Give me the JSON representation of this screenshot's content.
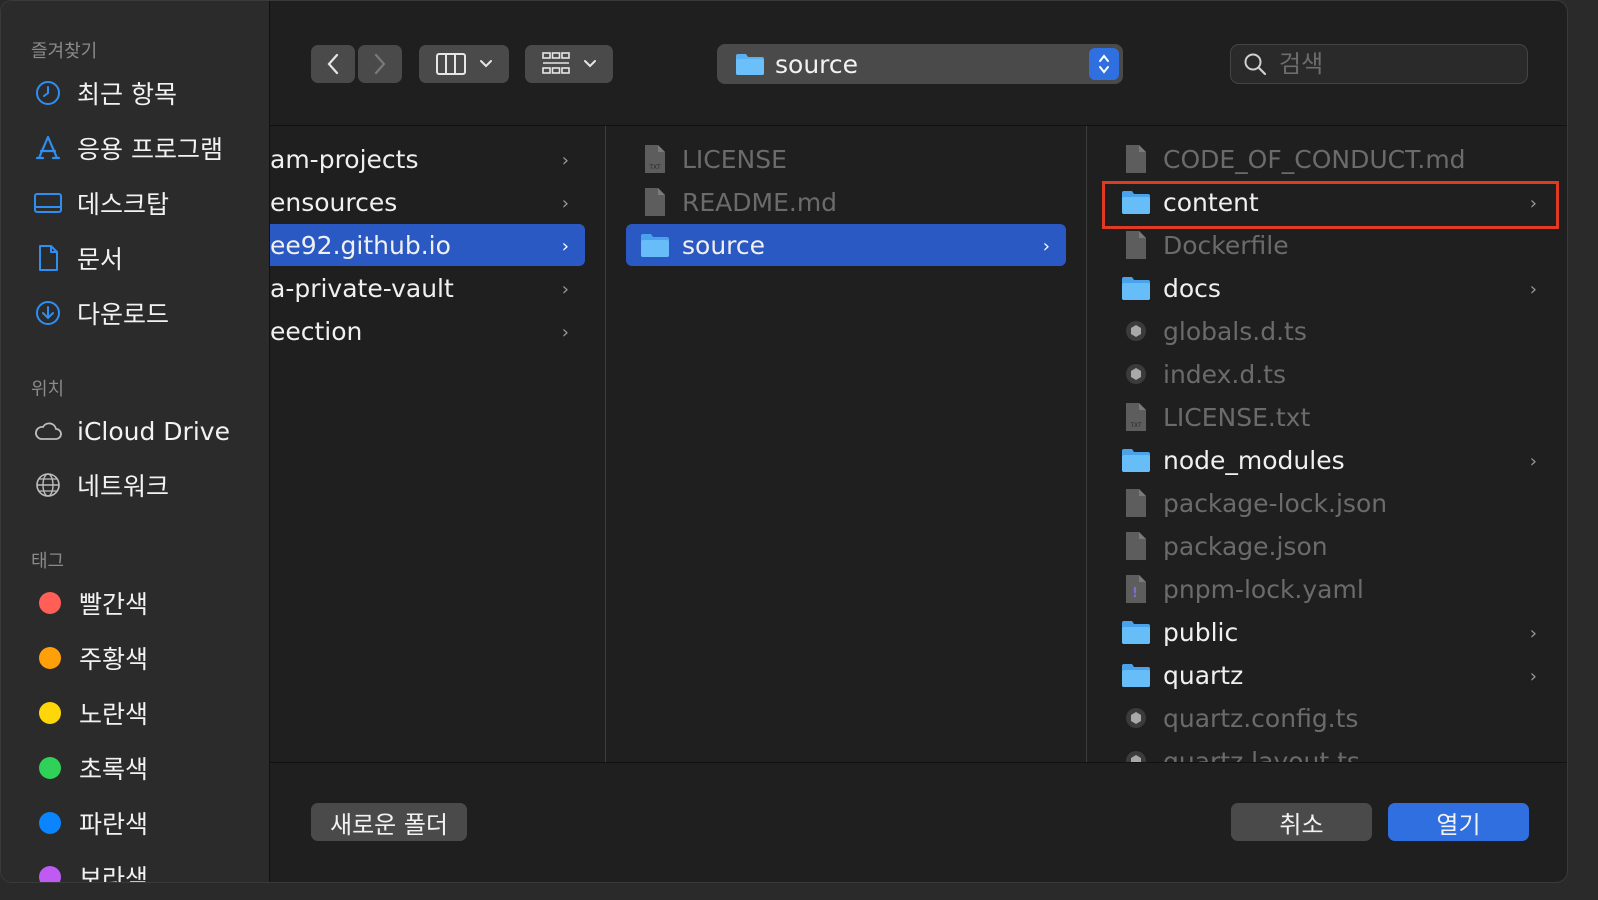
{
  "sidebar": {
    "favorites_header": "즐겨찾기",
    "favorites": [
      {
        "label": "최근 항목",
        "icon": "clock-icon"
      },
      {
        "label": "응용 프로그램",
        "icon": "applications-icon"
      },
      {
        "label": "데스크탑",
        "icon": "desktop-icon"
      },
      {
        "label": "문서",
        "icon": "document-icon"
      },
      {
        "label": "다운로드",
        "icon": "download-icon"
      }
    ],
    "locations_header": "위치",
    "locations": [
      {
        "label": "iCloud Drive",
        "icon": "cloud-icon"
      },
      {
        "label": "네트워크",
        "icon": "globe-icon"
      }
    ],
    "tags_header": "태그",
    "tags": [
      {
        "label": "빨간색",
        "color": "#ff5f57"
      },
      {
        "label": "주황색",
        "color": "#ff9f0a"
      },
      {
        "label": "노란색",
        "color": "#ffd60a"
      },
      {
        "label": "초록색",
        "color": "#30d158"
      },
      {
        "label": "파란색",
        "color": "#0a84ff"
      },
      {
        "label": "보라색",
        "color": "#bf5af2"
      }
    ]
  },
  "toolbar": {
    "path_label": "source",
    "search_placeholder": "검색"
  },
  "columns": {
    "col1": [
      {
        "label": "am-projects",
        "has_children": true
      },
      {
        "label": "ensources",
        "has_children": true
      },
      {
        "label": "ee92.github.io",
        "has_children": true,
        "selected": true
      },
      {
        "label": "a-private-vault",
        "has_children": true
      },
      {
        "label": "eection",
        "has_children": true
      }
    ],
    "col2": [
      {
        "label": "LICENSE",
        "icon": "txt-file-icon"
      },
      {
        "label": "README.md",
        "icon": "file-icon"
      },
      {
        "label": "source",
        "icon": "folder-icon",
        "selected": true
      }
    ],
    "col3": [
      {
        "label": "CODE_OF_CONDUCT.md",
        "icon": "file-icon"
      },
      {
        "label": "content",
        "icon": "folder-icon"
      },
      {
        "label": "Dockerfile",
        "icon": "file-icon"
      },
      {
        "label": "docs",
        "icon": "folder-icon"
      },
      {
        "label": "globals.d.ts",
        "icon": "ts-file-icon"
      },
      {
        "label": "index.d.ts",
        "icon": "ts-file-icon"
      },
      {
        "label": "LICENSE.txt",
        "icon": "txt-file-icon"
      },
      {
        "label": "node_modules",
        "icon": "folder-icon"
      },
      {
        "label": "package-lock.json",
        "icon": "file-icon"
      },
      {
        "label": "package.json",
        "icon": "file-icon"
      },
      {
        "label": "pnpm-lock.yaml",
        "icon": "yaml-file-icon"
      },
      {
        "label": "public",
        "icon": "folder-icon"
      },
      {
        "label": "quartz",
        "icon": "folder-icon"
      },
      {
        "label": "quartz.config.ts",
        "icon": "ts-file-icon"
      },
      {
        "label": "quartz.layout.ts",
        "icon": "ts-file-icon"
      }
    ]
  },
  "footer": {
    "new_folder_label": "새로운 폴더",
    "cancel_label": "취소",
    "open_label": "열기"
  },
  "colors": {
    "accent": "#2b59c3",
    "highlight_box": "#e03a22",
    "folder": "#5ab0f0"
  }
}
